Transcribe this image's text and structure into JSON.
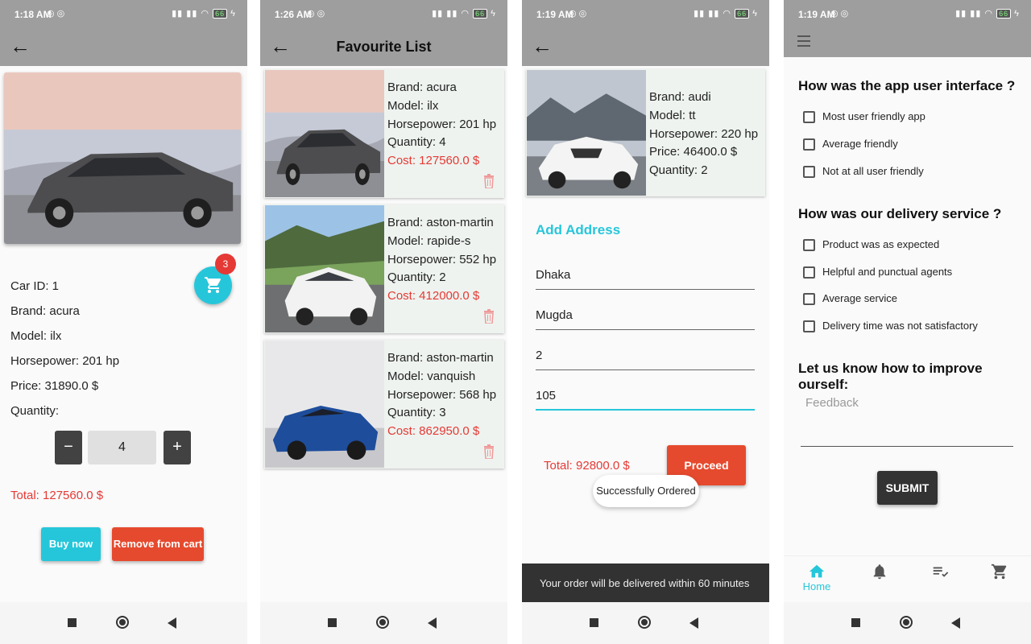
{
  "colors": {
    "accent": "#26c6da",
    "danger": "#e53935",
    "appbar": "#9e9e9e",
    "dark": "#333333"
  },
  "screen1": {
    "status_time": "1:18 AM",
    "battery": "66",
    "car_id": "Car ID: 1",
    "brand": "Brand: acura",
    "model": "Model: ilx",
    "horsepower": "Horsepower: 201 hp",
    "price": "Price: 31890.0 $",
    "quantity_label": "Quantity:",
    "quantity_value": "4",
    "decrement": "−",
    "increment": "+",
    "cart_badge": "3",
    "total": "Total: 127560.0 $",
    "buy_now": "Buy now",
    "remove_from_cart": "Remove from cart"
  },
  "screen2": {
    "status_time": "1:26 AM",
    "battery": "66",
    "title": "Favourite List",
    "items": [
      {
        "brand": "Brand: acura",
        "model": "Model: ilx",
        "horsepower": "Horsepower: 201 hp",
        "quantity": "Quantity: 4",
        "cost": "Cost: 127560.0 $"
      },
      {
        "brand": "Brand: aston-martin",
        "model": "Model: rapide-s",
        "horsepower": "Horsepower: 552 hp",
        "quantity": "Quantity: 2",
        "cost": "Cost: 412000.0 $"
      },
      {
        "brand": "Brand: aston-martin",
        "model": "Model: vanquish",
        "horsepower": "Horsepower: 568 hp",
        "quantity": "Quantity: 3",
        "cost": "Cost: 862950.0 $"
      }
    ]
  },
  "screen3": {
    "status_time": "1:19 AM",
    "battery": "66",
    "brand": "Brand: audi",
    "model": "Model: tt",
    "horsepower": "Horsepower: 220 hp",
    "price": "Price: 46400.0 $",
    "quantity": "Quantity: 2",
    "add_address": "Add Address",
    "fields": [
      "Dhaka",
      "Mugda",
      "2",
      "105"
    ],
    "total": "Total: 92800.0 $",
    "proceed": "Proceed",
    "toast": "Successfully Ordered",
    "snackbar": "Your order will be delivered within 60 minutes"
  },
  "screen4": {
    "status_time": "1:19 AM",
    "battery": "66",
    "q1": "How was the app user interface ?",
    "q1_options": [
      "Most user friendly app",
      "Average friendly",
      "Not at all user friendly"
    ],
    "q2": "How was our delivery service ?",
    "q2_options": [
      "Product was as expected",
      "Helpful and punctual agents",
      "Average service",
      "Delivery time was not satisfactory"
    ],
    "q3": "Let us know how to improve ourself:",
    "feedback_placeholder": "Feedback",
    "submit": "SUBMIT",
    "nav_home": "Home",
    "nav_icons": [
      "home-icon",
      "bell-icon",
      "checklist-icon",
      "cart-icon"
    ]
  }
}
